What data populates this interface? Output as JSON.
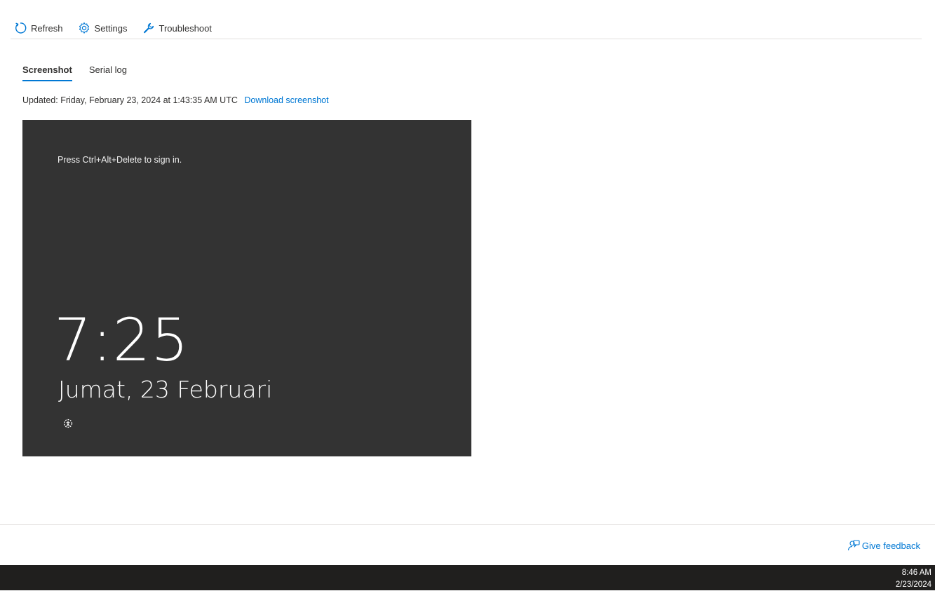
{
  "toolbar": {
    "refresh_label": "Refresh",
    "settings_label": "Settings",
    "troubleshoot_label": "Troubleshoot"
  },
  "tabs": [
    {
      "label": "Screenshot",
      "active": true
    },
    {
      "label": "Serial log",
      "active": false
    }
  ],
  "status": {
    "updated_text": "Updated: Friday, February 23, 2024 at 1:43:35 AM UTC",
    "download_link": "Download screenshot"
  },
  "screenshot": {
    "prompt": "Press Ctrl+Alt+Delete to sign in.",
    "time": "7:25",
    "date": "Jumat, 23 Februari",
    "ease_icon": "ease-of-access-icon"
  },
  "footer": {
    "feedback_label": "Give feedback"
  },
  "taskbar": {
    "time": "8:46 AM",
    "date": "2/23/2024"
  },
  "colors": {
    "accent": "#0078d4",
    "screenshot_bg": "#333333",
    "taskbar_bg": "#201f1e"
  }
}
